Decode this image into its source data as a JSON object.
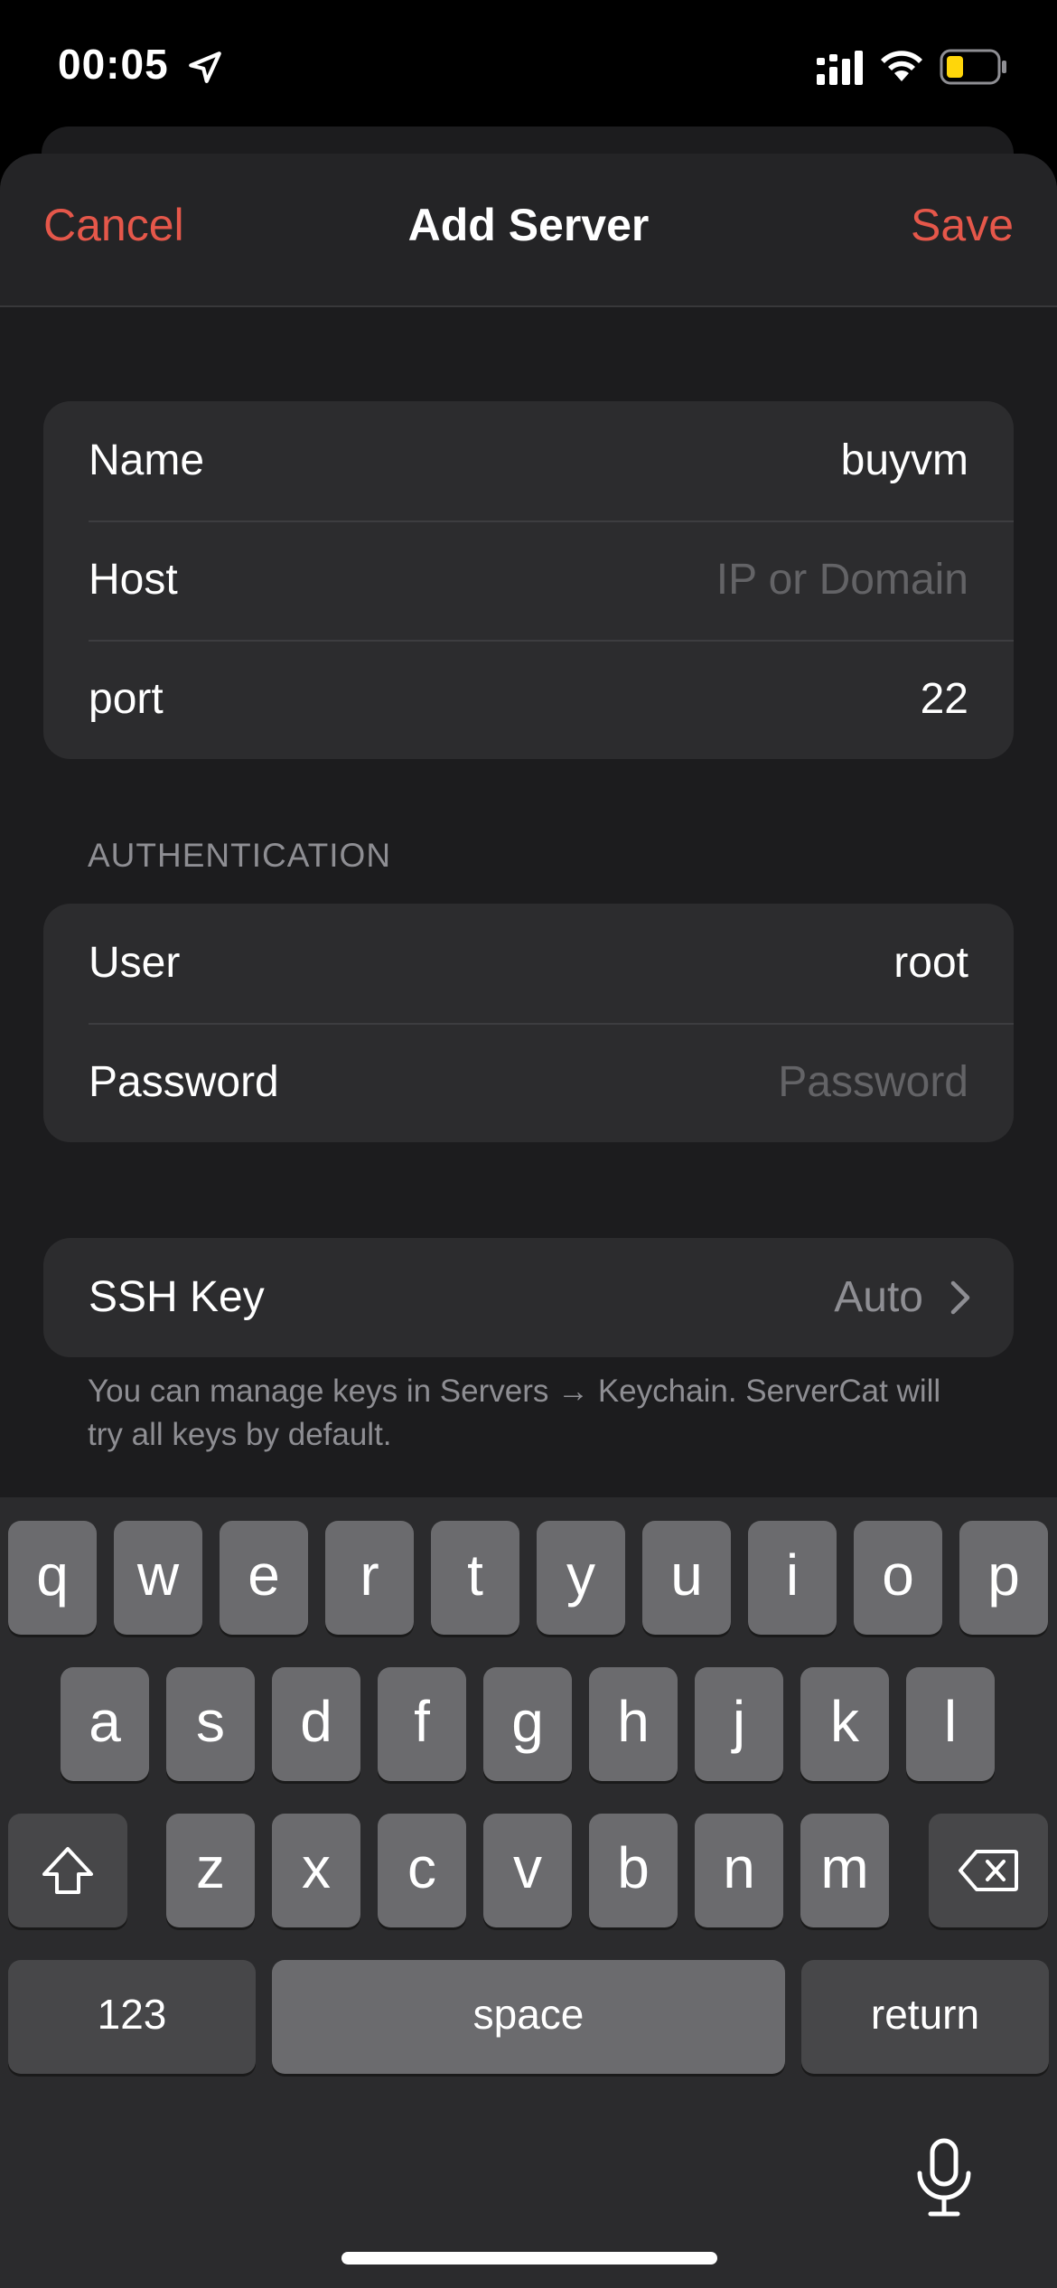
{
  "status_bar": {
    "time": "00:05"
  },
  "nav": {
    "cancel": "Cancel",
    "title": "Add Server",
    "save": "Save"
  },
  "server": {
    "name": {
      "label": "Name",
      "value": "buyvm"
    },
    "host": {
      "label": "Host",
      "placeholder": "IP or Domain"
    },
    "port": {
      "label": "port",
      "value": "22"
    }
  },
  "authentication": {
    "header": "AUTHENTICATION",
    "user": {
      "label": "User",
      "value": "root"
    },
    "password": {
      "label": "Password",
      "placeholder": "Password"
    }
  },
  "ssh_key": {
    "label": "SSH Key",
    "value": "Auto",
    "footnote": "You can manage keys in Servers → Keychain. ServerCat will try all keys by default."
  },
  "keyboard": {
    "row1": [
      "q",
      "w",
      "e",
      "r",
      "t",
      "y",
      "u",
      "i",
      "o",
      "p"
    ],
    "row2": [
      "a",
      "s",
      "d",
      "f",
      "g",
      "h",
      "j",
      "k",
      "l"
    ],
    "row3": [
      "z",
      "x",
      "c",
      "v",
      "b",
      "n",
      "m"
    ],
    "numbers": "123",
    "space": "space",
    "return": "return"
  },
  "colors": {
    "accent": "#e5574a",
    "background": "#1c1c1e",
    "cell": "#2c2c2e"
  }
}
